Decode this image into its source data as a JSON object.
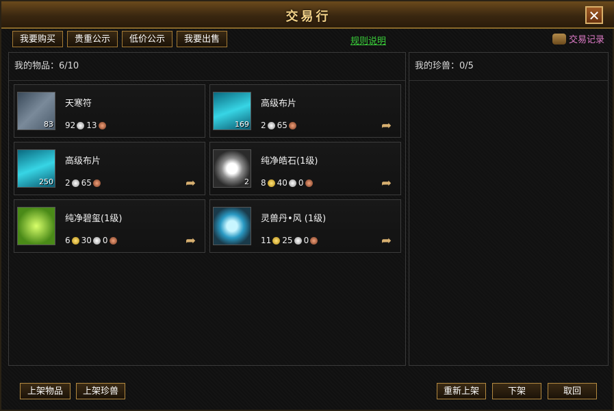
{
  "window": {
    "title": "交易行"
  },
  "tabs": [
    "我要购买",
    "贵重公示",
    "低价公示",
    "我要出售"
  ],
  "links": {
    "rules": "规则说明",
    "records": "交易记录"
  },
  "left_panel": {
    "title": "我的物品：6/10",
    "items": [
      {
        "name": "天寒符",
        "count": "83",
        "icon": "scroll-icon",
        "price": [
          {
            "amount": "92",
            "coin": "silver"
          },
          {
            "amount": "13",
            "coin": "copper"
          }
        ]
      },
      {
        "name": "高级布片",
        "count": "169",
        "icon": "cloth-icon",
        "price": [
          {
            "amount": "2",
            "coin": "silver"
          },
          {
            "amount": "65",
            "coin": "copper"
          }
        ]
      },
      {
        "name": "高级布片",
        "count": "250",
        "icon": "cloth-icon",
        "price": [
          {
            "amount": "2",
            "coin": "silver"
          },
          {
            "amount": "65",
            "coin": "copper"
          }
        ]
      },
      {
        "name": "纯净皓石(1级)",
        "count": "2",
        "icon": "diamond-icon",
        "price": [
          {
            "amount": "8",
            "coin": "gold"
          },
          {
            "amount": "40",
            "coin": "silver"
          },
          {
            "amount": "0",
            "coin": "copper"
          }
        ]
      },
      {
        "name": "纯净碧玺(1级)",
        "count": "",
        "icon": "jade-icon",
        "price": [
          {
            "amount": "6",
            "coin": "gold"
          },
          {
            "amount": "30",
            "coin": "silver"
          },
          {
            "amount": "0",
            "coin": "copper"
          }
        ]
      },
      {
        "name": "灵兽丹•风 (1级)",
        "count": "",
        "icon": "orb-icon",
        "price": [
          {
            "amount": "11",
            "coin": "gold"
          },
          {
            "amount": "25",
            "coin": "silver"
          },
          {
            "amount": "0",
            "coin": "copper"
          }
        ]
      }
    ]
  },
  "right_panel": {
    "title": "我的珍兽：0/5"
  },
  "bottom_buttons": {
    "list_item": "上架物品",
    "list_pet": "上架珍兽",
    "relist": "重新上架",
    "delist": "下架",
    "cancel": "取回"
  },
  "colors": {
    "title_text": "#f5d48a",
    "rules_link": "#3ad03a",
    "records_link": "#e07cc9",
    "border_gold": "#b48a40"
  }
}
